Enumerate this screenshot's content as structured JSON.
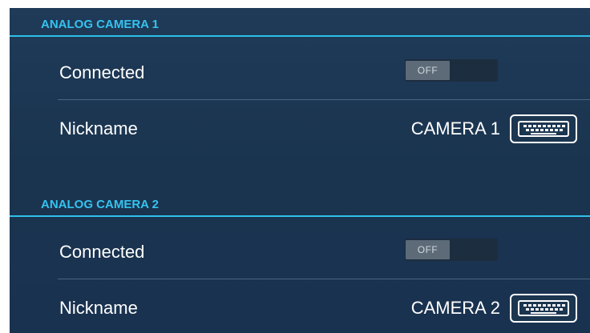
{
  "sections": [
    {
      "title": "ANALOG CAMERA 1",
      "connected": {
        "label": "Connected",
        "toggle_state": "OFF"
      },
      "nickname": {
        "label": "Nickname",
        "value": "CAMERA 1",
        "icon": "keyboard-icon"
      }
    },
    {
      "title": "ANALOG CAMERA 2",
      "connected": {
        "label": "Connected",
        "toggle_state": "OFF"
      },
      "nickname": {
        "label": "Nickname",
        "value": "CAMERA 2",
        "icon": "keyboard-icon"
      }
    }
  ],
  "colors": {
    "accent": "#35c3ef",
    "background": "#1d3854",
    "text": "#ffffff",
    "toggle_off": "#5d6b78"
  }
}
